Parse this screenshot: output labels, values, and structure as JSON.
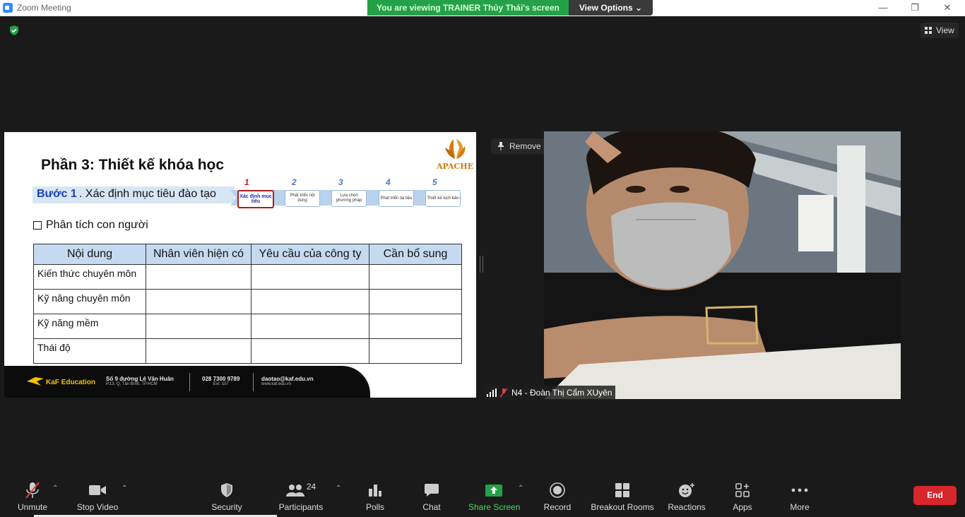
{
  "window": {
    "title": "Zoom Meeting",
    "minimize_icon": "minimize-icon",
    "restore_icon": "restore-icon",
    "close_icon": "close-icon"
  },
  "banner": {
    "viewing_text": "You are viewing TRAINER Thủy Thái's screen",
    "view_options_label": "View Options",
    "color": "#24a148"
  },
  "top_right": {
    "view_label": "View"
  },
  "slide": {
    "title": "Phần 3: Thiết kế khóa học",
    "logo_text": "APACHE",
    "step_prefix": "Bước 1",
    "step_text": ". Xác định mục tiêu đào tạo",
    "steps": [
      {
        "num": "1",
        "label": "Xác định mục tiêu"
      },
      {
        "num": "2",
        "label": "Phát triển nội dung"
      },
      {
        "num": "3",
        "label": "Lựa chọn phương pháp"
      },
      {
        "num": "4",
        "label": "Phát triển tài liệu"
      },
      {
        "num": "5",
        "label": "Thiết kế kịch bản"
      }
    ],
    "checkbox_item": "Phân tích con người",
    "table": {
      "headers": [
        "Nội dung",
        "Nhân viên hiện có",
        "Yêu cầu của công ty",
        "Cần bổ sung"
      ],
      "rows": [
        "Kiến thức chuyên môn",
        "Kỹ năng chuyên môn",
        "Kỹ năng mềm",
        "Thái độ"
      ]
    },
    "footer": {
      "brand": "KaF Education",
      "address_line1": "Số 9 đường Lê Văn Huân",
      "address_line2": "P.13, Q. Tân Bình, TP.HCM",
      "phone": "028 7300 9789",
      "ext": "Ext: 107",
      "email": "daotao@kaf.edu.vn",
      "website": "www.kaf.edu.vn"
    }
  },
  "video": {
    "remove_pin_label": "Remove Pin",
    "participant_name": "N4 - Đoàn Thị Cẩm XUyên"
  },
  "toolbar": {
    "unmute": "Unmute",
    "stop_video": "Stop Video",
    "security": "Security",
    "participants": "Participants",
    "participants_count": "24",
    "polls": "Polls",
    "chat": "Chat",
    "share_screen": "Share Screen",
    "record": "Record",
    "breakout_rooms": "Breakout Rooms",
    "reactions": "Reactions",
    "apps": "Apps",
    "more": "More",
    "end": "End",
    "end_color": "#d7262c",
    "share_color": "#24a148"
  }
}
